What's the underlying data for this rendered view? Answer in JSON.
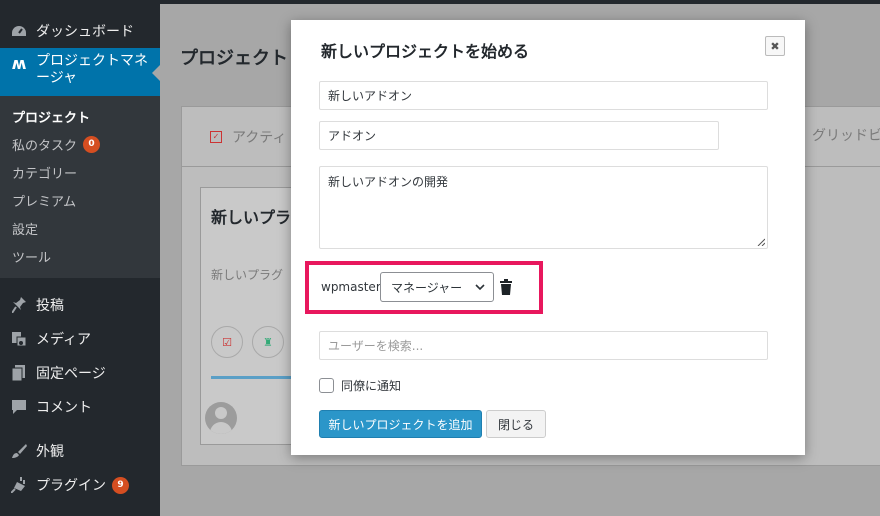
{
  "sidebar": {
    "dashboard": "ダッシュボード",
    "project_manager": "プロジェクトマネージャ",
    "submenu": [
      {
        "label": "プロジェクト"
      },
      {
        "label": "私のタスク",
        "badge": "0"
      },
      {
        "label": "カテゴリー"
      },
      {
        "label": "プレミアム"
      },
      {
        "label": "設定"
      },
      {
        "label": "ツール"
      }
    ],
    "posts": "投稿",
    "media": "メディア",
    "pages": "固定ページ",
    "comments": "コメント",
    "appearance": "外観",
    "plugins": "プラグイン",
    "plugins_badge": "9"
  },
  "background": {
    "page_title": "プロジェクト",
    "tab_active": "アクティ",
    "tab_grid": "グリッドビ",
    "card_title": "新しいプラ",
    "card_desc": "新しいプラグ"
  },
  "modal": {
    "title": "新しいプロジェクトを始める",
    "close": "✖",
    "project_name": "新しいアドオン",
    "category": "アドオン",
    "description": "新しいアドオンの開発",
    "user_label": "wpmaster",
    "role_value": "マネージャー",
    "user_search_placeholder": "ユーザーを検索...",
    "notify_label": "同僚に通知",
    "submit_label": "新しいプロジェクトを追加",
    "cancel_label": "閉じる"
  },
  "colors": {
    "accent": "#0073aa",
    "primary_button": "#2b96c9",
    "highlight": "#e8175d",
    "badge": "#d54e21"
  }
}
